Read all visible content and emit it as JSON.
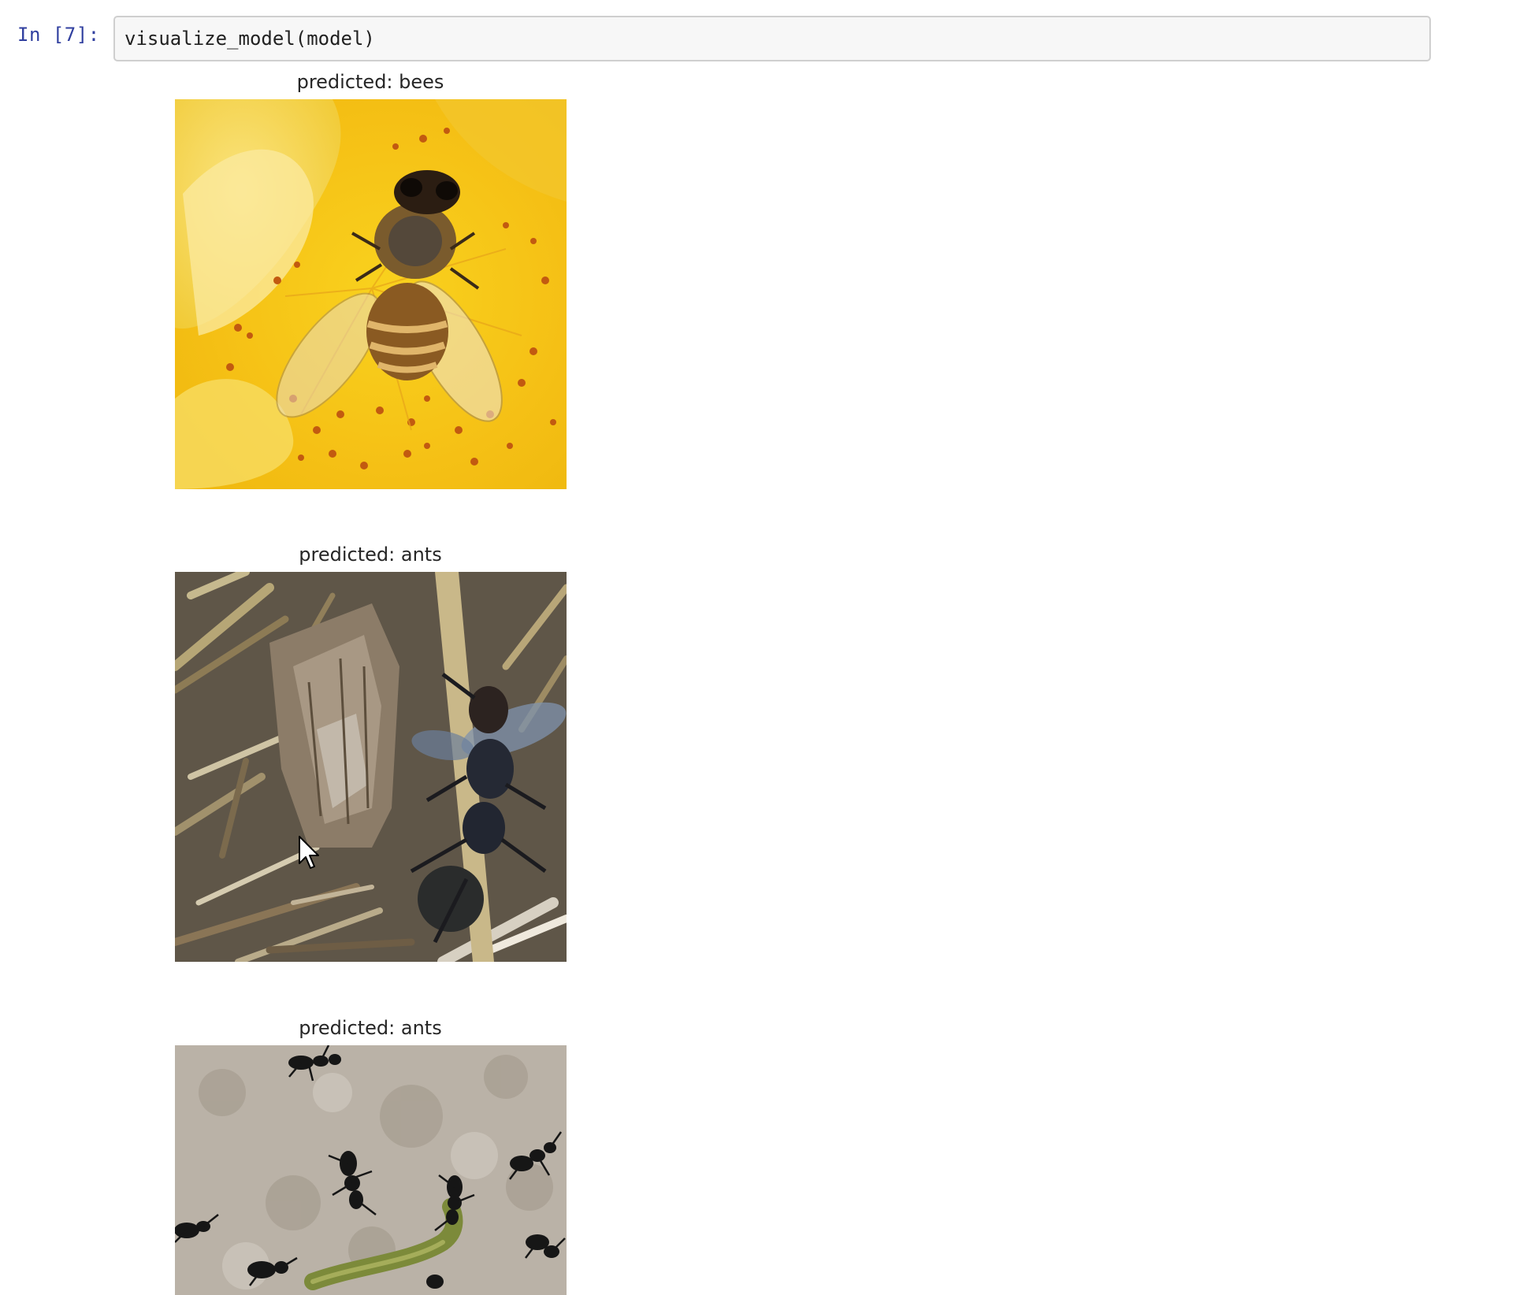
{
  "cell": {
    "prompt": "In [7]:",
    "code": "visualize_model(model)"
  },
  "outputs": [
    {
      "title": "predicted: bees",
      "subject": "bee-on-yellow-flower"
    },
    {
      "title": "predicted: ants",
      "subject": "ant-on-bark-debris"
    },
    {
      "title": "predicted: ants",
      "subject": "ants-on-soil"
    }
  ],
  "icons": {
    "cursor": "mouse-pointer-icon"
  },
  "colors": {
    "prompt": "#303f9f",
    "cell_border": "#cfcfcf",
    "cell_background": "#f7f7f7",
    "flower_yellow": "#f6c41c"
  }
}
